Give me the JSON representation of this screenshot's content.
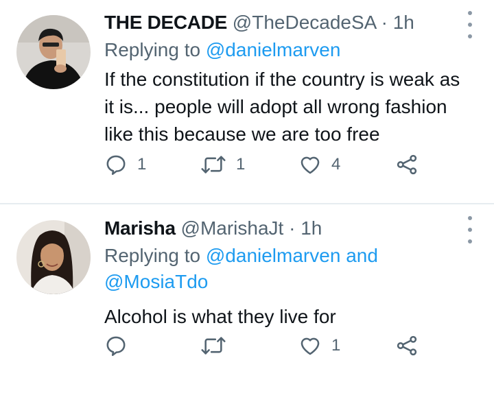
{
  "tweets": [
    {
      "name": "THE DECADE",
      "handle": "@TheDecadeSA",
      "separator": "·",
      "time": "1h",
      "replying_prefix": "Replying to",
      "replying_to": "@danielmarven",
      "replying_and": "",
      "replying_to_2": "",
      "text": "If the constitution if the country is weak as it is... people will adopt all wrong fashion like this because we are too free",
      "reply_count": "1",
      "retweet_count": "1",
      "like_count": "4"
    },
    {
      "name": "Marisha",
      "handle": "@MarishaJt",
      "separator": "·",
      "time": "1h",
      "replying_prefix": "Replying to",
      "replying_to": "@danielmarven",
      "replying_and": "and",
      "replying_to_2": "@MosiaTdo",
      "text": "Alcohol is what they live for",
      "reply_count": "",
      "retweet_count": "",
      "like_count": "1"
    }
  ],
  "colors": {
    "text": "#0f1419",
    "secondary": "#536471",
    "link": "#1d9bf0",
    "divider": "#e6ecf0"
  },
  "icons": [
    "more-vertical-icon",
    "reply-icon",
    "retweet-icon",
    "like-icon",
    "share-icon"
  ]
}
